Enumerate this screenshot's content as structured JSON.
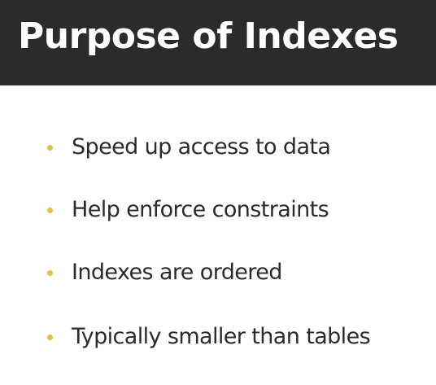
{
  "slide": {
    "title": "Purpose of Indexes",
    "bullets": [
      "Speed up access to data",
      "Help enforce constraints",
      "Indexes are ordered",
      "Typically smaller than tables"
    ]
  },
  "colors": {
    "header_background": "#2b2b2b",
    "title_text": "#ffffff",
    "bullet_marker": "#e2bf4a",
    "body_text": "#2b2b2b",
    "background": "#ffffff"
  }
}
